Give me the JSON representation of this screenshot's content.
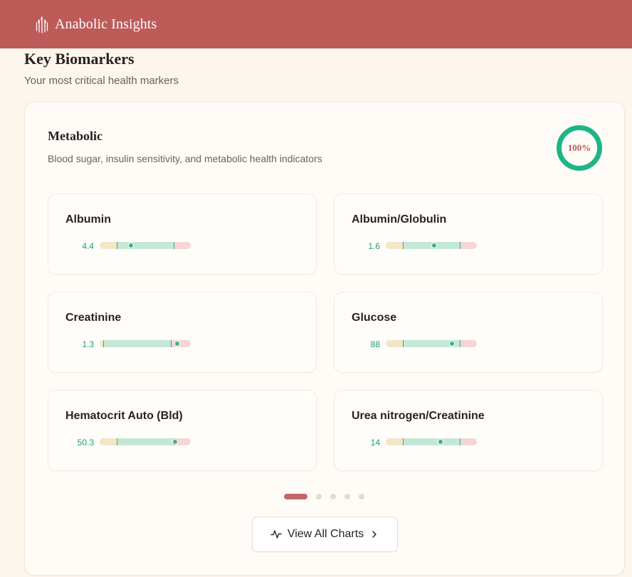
{
  "header": {
    "brand_name": "Anabolic Insights",
    "logo_icon": "wheat-logo-icon"
  },
  "section": {
    "title": "Key Biomarkers",
    "subtitle": "Your most critical health markers"
  },
  "category": {
    "title": "Metabolic",
    "description": "Blood sugar, insulin sensitivity, and metabolic health indicators",
    "score": "100%",
    "score_fraction": 1.0
  },
  "markers": [
    {
      "name": "Albumin",
      "value": "4.4",
      "low_fraction": 0.19,
      "ok_fraction": 0.63,
      "position_fraction": 0.34
    },
    {
      "name": "Albumin/Globulin",
      "value": "1.6",
      "low_fraction": 0.19,
      "ok_fraction": 0.63,
      "position_fraction": 0.53
    },
    {
      "name": "Creatinine",
      "value": "1.3",
      "low_fraction": 0.04,
      "ok_fraction": 0.75,
      "position_fraction": 0.85
    },
    {
      "name": "Glucose",
      "value": "88",
      "low_fraction": 0.19,
      "ok_fraction": 0.63,
      "position_fraction": 0.73
    },
    {
      "name": "Hematocrit Auto (Bld)",
      "value": "50.3",
      "low_fraction": 0.19,
      "ok_fraction": 0.63,
      "position_fraction": 0.83
    },
    {
      "name": "Urea nitrogen/Creatinine",
      "value": "14",
      "low_fraction": 0.19,
      "ok_fraction": 0.63,
      "position_fraction": 0.6
    }
  ],
  "pagination": {
    "pages": 5,
    "current": 1
  },
  "view_all": {
    "label": "View All Charts",
    "icon": "activity-icon",
    "trailing_icon": "chevron-right-icon"
  },
  "colors": {
    "header": "#bd5b59",
    "accent_green": "#1f9a77",
    "ring": "#1db586",
    "range_low": "#f3e6c6",
    "range_ok": "#c5e8d6",
    "range_high": "#f6d5d6"
  }
}
